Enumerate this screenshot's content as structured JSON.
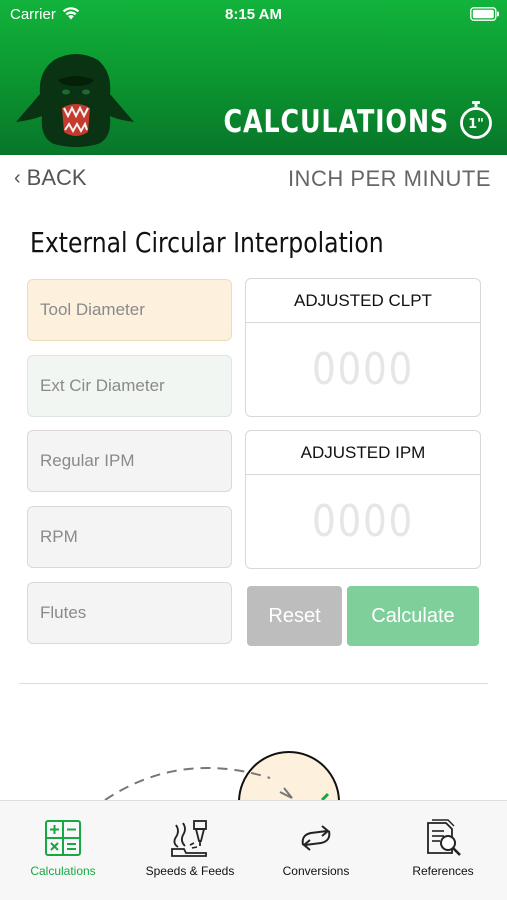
{
  "status_bar": {
    "carrier": "Carrier",
    "time": "8:15 AM"
  },
  "header": {
    "title": "CALCULATIONS",
    "stopwatch_badge": "1\"",
    "background_color": "#0c9a30"
  },
  "nav": {
    "back_label": "BACK",
    "mode_label": "INCH PER MINUTE"
  },
  "page_title": "External Circular Interpolation",
  "inputs": {
    "tool_diameter_placeholder": "Tool Diameter",
    "ext_cir_diameter_placeholder": "Ext Cir Diameter",
    "regular_ipm_placeholder": "Regular IPM",
    "rpm_placeholder": "RPM",
    "flutes_placeholder": "Flutes"
  },
  "results": {
    "adjusted_clpt_label": "ADJUSTED CLPT",
    "adjusted_clpt_value": "0000",
    "adjusted_ipm_label": "ADJUSTED IPM",
    "adjusted_ipm_value": "0000"
  },
  "buttons": {
    "reset_label": "Reset",
    "calculate_label": "Calculate"
  },
  "tab_bar": {
    "active_color": "#17a843",
    "tabs": [
      {
        "label": "Calculations",
        "icon": "calculator-icon",
        "active": true
      },
      {
        "label": "Speeds & Feeds",
        "icon": "cutting-tool-icon",
        "active": false
      },
      {
        "label": "Conversions",
        "icon": "conversion-arrows-icon",
        "active": false
      },
      {
        "label": "References",
        "icon": "document-search-icon",
        "active": false
      }
    ]
  }
}
